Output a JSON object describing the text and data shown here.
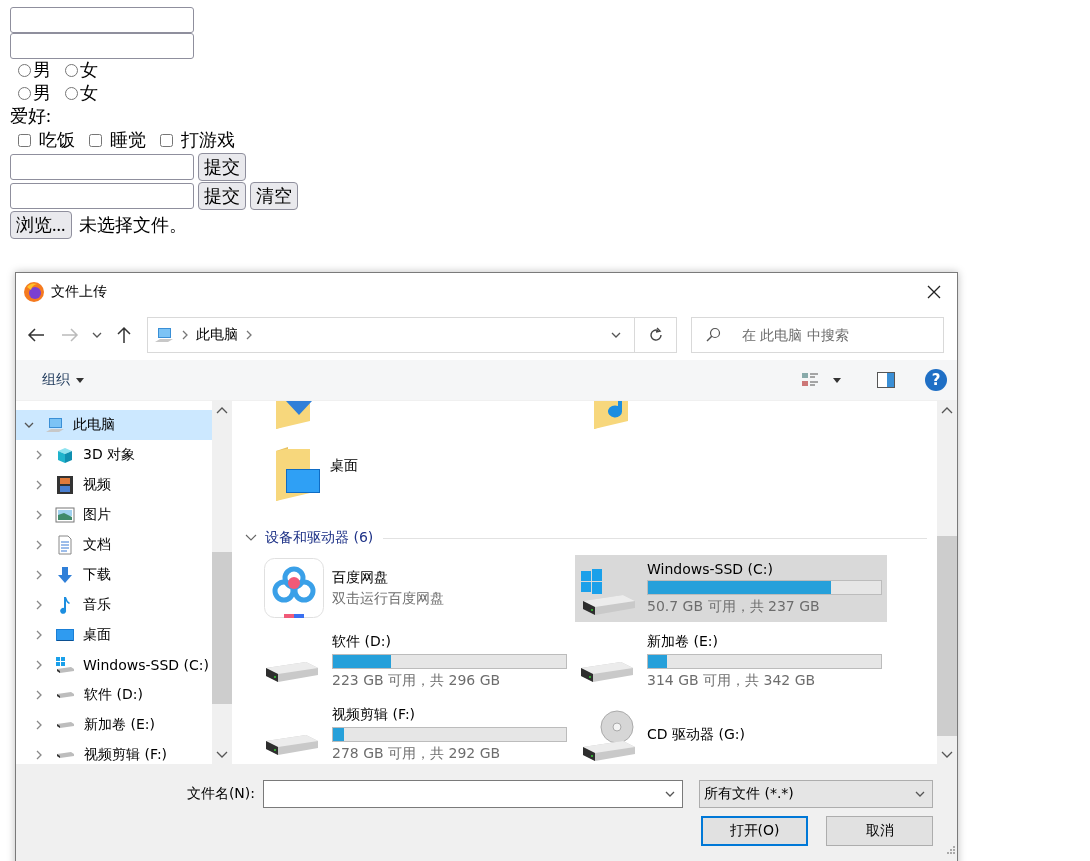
{
  "form": [
    {
      "kind": "text_input"
    },
    {
      "kind": "text_input"
    },
    {
      "kind": "radio_group",
      "options": [
        {
          "label": "男",
          "selected": false
        },
        {
          "label": "女",
          "selected": false
        }
      ]
    },
    {
      "kind": "radio_group",
      "options": [
        {
          "label": "男",
          "selected": false
        },
        {
          "label": "女",
          "selected": false
        }
      ]
    },
    {
      "kind": "label",
      "text": "爱好:"
    },
    {
      "kind": "checkbox_group",
      "options": [
        {
          "label": "吃饭",
          "checked": false
        },
        {
          "label": "睡觉",
          "checked": false
        },
        {
          "label": "打游戏",
          "checked": false
        }
      ]
    },
    {
      "kind": "input_with_buttons",
      "buttons": [
        "提交"
      ]
    },
    {
      "kind": "input_with_buttons",
      "buttons": [
        "提交",
        "清空"
      ]
    },
    {
      "kind": "file_input",
      "button": "浏览...",
      "status": "未选择文件。"
    }
  ],
  "dialog": {
    "title": "文件上传",
    "address": {
      "path": [
        "此电脑"
      ]
    },
    "search": {
      "placeholder": "在 此电脑 中搜索"
    },
    "toolbar": {
      "organize": "组织",
      "help": "?"
    },
    "sidebar": {
      "items": [
        {
          "label": "此电脑",
          "kind": "computer",
          "expanded": true,
          "selected": true,
          "children": [
            {
              "label": "3D 对象",
              "kind": "cube",
              "expanded": false,
              "selected": false
            },
            {
              "label": "视频",
              "kind": "film",
              "expanded": false,
              "selected": false
            },
            {
              "label": "图片",
              "kind": "image",
              "expanded": false,
              "selected": false
            },
            {
              "label": "文档",
              "kind": "document",
              "expanded": false,
              "selected": false
            },
            {
              "label": "下载",
              "kind": "download",
              "expanded": false,
              "selected": false
            },
            {
              "label": "音乐",
              "kind": "music",
              "expanded": false,
              "selected": false
            },
            {
              "label": "桌面",
              "kind": "desktop",
              "expanded": false,
              "selected": false
            },
            {
              "label": "Windows-SSD (C:)",
              "kind": "windows-drive",
              "expanded": false,
              "selected": false
            },
            {
              "label": "软件 (D:)",
              "kind": "drive",
              "expanded": false,
              "selected": false
            },
            {
              "label": "新加卷 (E:)",
              "kind": "drive",
              "expanded": false,
              "selected": false
            },
            {
              "label": "视频剪辑 (F:)",
              "kind": "drive",
              "expanded": false,
              "selected": false
            }
          ]
        }
      ]
    },
    "folders": [
      {
        "kind": "folder-download"
      },
      {
        "kind": "folder-music"
      },
      {
        "kind": "folder-desktop",
        "label": "桌面"
      }
    ],
    "devices": {
      "header": "设备和驱动器 (6)",
      "expanded": true,
      "items": [
        {
          "kind": "app",
          "name": "百度网盘",
          "subtitle": "双击运行百度网盘",
          "selected": false
        },
        {
          "kind": "windows-drive",
          "name": "Windows-SSD (C:)",
          "level": 0.786,
          "reading": "50.7 GB 可用，共 237 GB",
          "selected": true
        },
        {
          "kind": "drive",
          "name": "软件 (D:)",
          "level": 0.247,
          "reading": "223 GB 可用，共 296 GB",
          "selected": false
        },
        {
          "kind": "drive",
          "name": "新加卷 (E:)",
          "level": 0.082,
          "reading": "314 GB 可用，共 342 GB",
          "selected": false
        },
        {
          "kind": "drive",
          "name": "视频剪辑 (F:)",
          "level": 0.048,
          "reading": "278 GB 可用，共 292 GB",
          "selected": false
        },
        {
          "kind": "cd",
          "name": "CD 驱动器 (G:)",
          "selected": false
        }
      ]
    },
    "footer": {
      "filename_label": "文件名(N):",
      "file_type": "所有文件 (*.*)",
      "buttons": [
        {
          "label": "打开(O)",
          "default": true
        },
        {
          "label": "取消",
          "default": false
        }
      ]
    }
  }
}
